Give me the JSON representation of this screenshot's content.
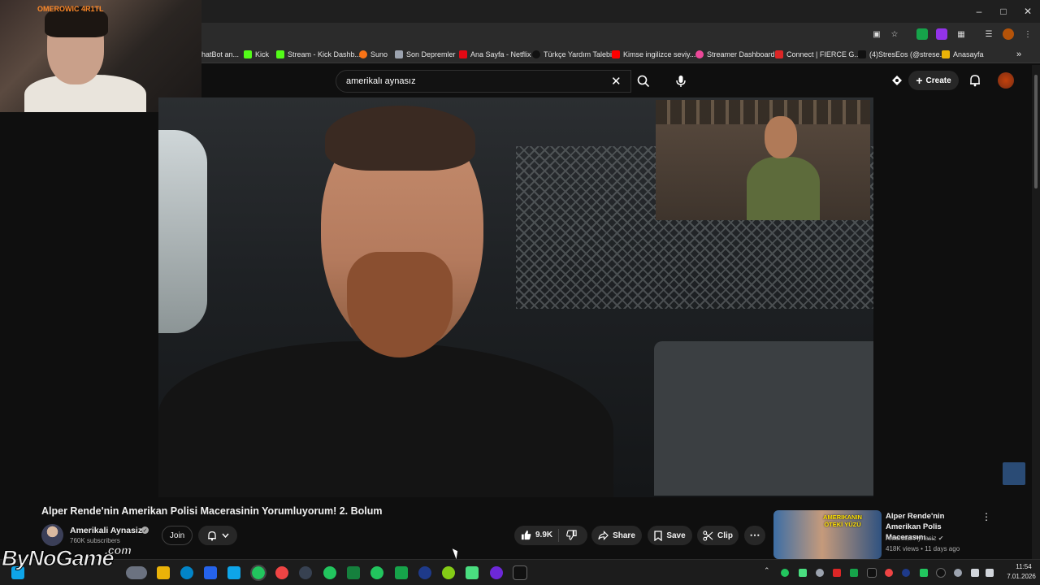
{
  "webcam": {
    "label": "OMEROWIC 4R1TL"
  },
  "bookmarks": [
    {
      "label": "hatBot an...",
      "color": "#3b82f6"
    },
    {
      "label": "Kick",
      "color": "#53fc18"
    },
    {
      "label": "Stream - Kick Dashb...",
      "color": "#53fc18"
    },
    {
      "label": "Suno",
      "color": "#f97316"
    },
    {
      "label": "Son Depremler",
      "color": "#9ca3af"
    },
    {
      "label": "Ana Sayfa - Netflix",
      "color": "#e50914"
    },
    {
      "label": "Türkçe Yardım Talebi",
      "color": "#111111"
    },
    {
      "label": "Kimse ingilizce seviy...",
      "color": "#ff0000"
    },
    {
      "label": "Streamer Dashboard",
      "color": "#ec4899"
    },
    {
      "label": "Connect | FIERCE G...",
      "color": "#dc2626"
    },
    {
      "label": "(4)StresEos (@strese...",
      "color": "#111111"
    },
    {
      "label": "Anasayfa",
      "color": "#eab308"
    }
  ],
  "search": {
    "query": "amerikalı aynasız"
  },
  "header": {
    "create_label": "Create"
  },
  "video": {
    "title": "Alper Rende'nin Amerikan Polisi Macerasinin Yorumluyorum! 2. Bolum",
    "channel_name": "Amerikali Aynasiz",
    "subscribers": "760K subscribers",
    "join_label": "Join",
    "likes": "9.9K",
    "share_label": "Share",
    "save_label": "Save",
    "clip_label": "Clip"
  },
  "recommended": {
    "title": "Alper Rende'nin Amerikan Polis Macerasını ...",
    "channel": "Amerikali Aynasiz",
    "meta": "418K views • 11 days ago",
    "thumb_text": "AMERIKANIN ÖTEKİ YÜZÜ"
  },
  "taskbar": {
    "time": "11:54",
    "date": "7.01.2026"
  },
  "watermark": {
    "main": "ByNoGame",
    "sub": ".com"
  },
  "colors": {
    "background": "#0f0f0f",
    "pill": "#272727",
    "text": "#f1f1f1",
    "muted": "#aaaaaa"
  }
}
